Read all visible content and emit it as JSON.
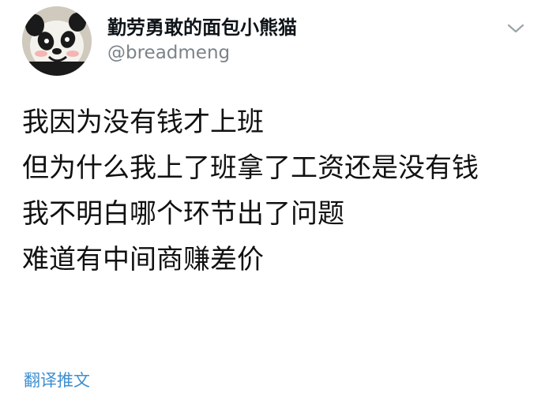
{
  "profile": {
    "display_name": "勤劳勇敢的面包小熊猫",
    "handle": "@breadmeng",
    "avatar_icon": "panda-avatar-icon",
    "menu_icon": "chevron-down-icon"
  },
  "tweet": {
    "lines": [
      "我因为没有钱才上班",
      "但为什么我上了班拿了工资还是没有钱",
      "我不明白哪个环节出了问题",
      "难道有中间商赚差价"
    ]
  },
  "actions": {
    "translate_label": "翻译推文"
  },
  "colors": {
    "text": "#111111",
    "handle": "#7b8389",
    "link": "#3d8fd1"
  }
}
